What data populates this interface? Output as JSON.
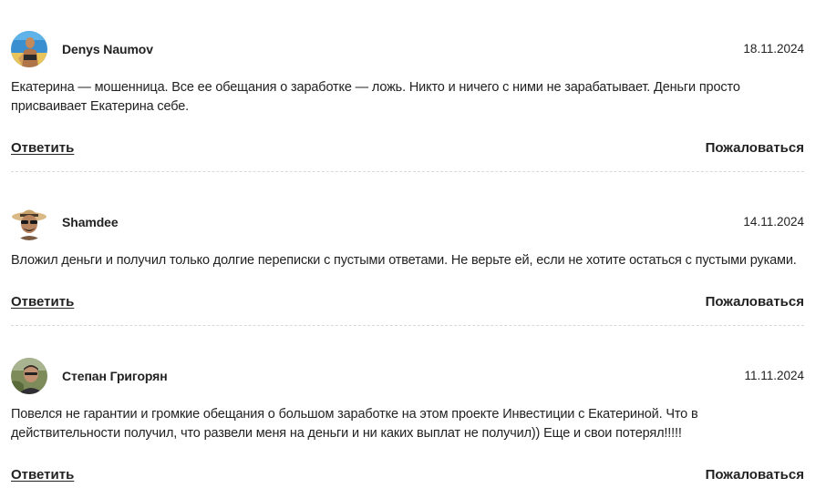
{
  "comments": [
    {
      "author": "Denys Naumov",
      "date": "18.11.2024",
      "text": "Екатерина — мошенница. Все ее обещания о заработке — ложь. Никто и ничего с ними не зарабатывает. Деньги просто присваивает Екатерина себе.",
      "reply_label": "Ответить",
      "report_label": "Пожаловаться",
      "avatar": "avatar-photo-beach"
    },
    {
      "author": "Shamdee",
      "date": "14.11.2024",
      "text": "Вложил деньги и получил только долгие переписки с пустыми ответами. Не верьте ей, если не хотите остаться с пустыми руками.",
      "reply_label": "Ответить",
      "report_label": "Пожаловаться",
      "avatar": "avatar-photo-hat-sunglasses"
    },
    {
      "author": "Степан Григорян",
      "date": "11.11.2024",
      "text": "Повелся не гарантии и громкие обещания о большом заработке на этом проекте Инвестиции с Екатериной. Что в действительности получил, что развели меня на деньги и ни каких выплат не получил)) Еще и свои потерял!!!!!",
      "reply_label": "Ответить",
      "report_label": "Пожаловаться",
      "avatar": "avatar-photo-outdoor"
    }
  ]
}
